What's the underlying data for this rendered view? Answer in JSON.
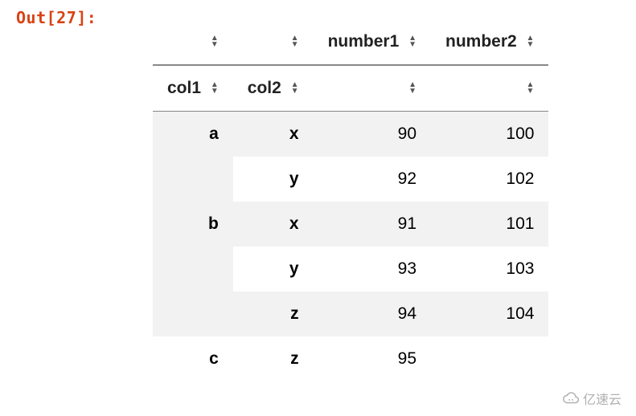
{
  "prompt": "Out[27]:",
  "headers": {
    "col_number1": "number1",
    "col_number2": "number2",
    "idx_col1": "col1",
    "idx_col2": "col2"
  },
  "rows": [
    {
      "col1": "a",
      "col2": "x",
      "number1": "90",
      "number2": "100"
    },
    {
      "col1": "",
      "col2": "y",
      "number1": "92",
      "number2": "102"
    },
    {
      "col1": "b",
      "col2": "x",
      "number1": "91",
      "number2": "101"
    },
    {
      "col1": "",
      "col2": "y",
      "number1": "93",
      "number2": "103"
    },
    {
      "col1": "",
      "col2": "z",
      "number1": "94",
      "number2": "104"
    },
    {
      "col1": "c",
      "col2": "z",
      "number1": "95",
      "number2": ""
    }
  ],
  "watermark": "亿速云",
  "chart_data": {
    "type": "table",
    "title": "Out[27]",
    "index_names": [
      "col1",
      "col2"
    ],
    "columns": [
      "number1",
      "number2"
    ],
    "index": [
      [
        "a",
        "x"
      ],
      [
        "a",
        "y"
      ],
      [
        "b",
        "x"
      ],
      [
        "b",
        "y"
      ],
      [
        "b",
        "z"
      ],
      [
        "c",
        "z"
      ]
    ],
    "data": [
      [
        90,
        100
      ],
      [
        92,
        102
      ],
      [
        91,
        101
      ],
      [
        93,
        103
      ],
      [
        94,
        104
      ],
      [
        95,
        null
      ]
    ]
  }
}
